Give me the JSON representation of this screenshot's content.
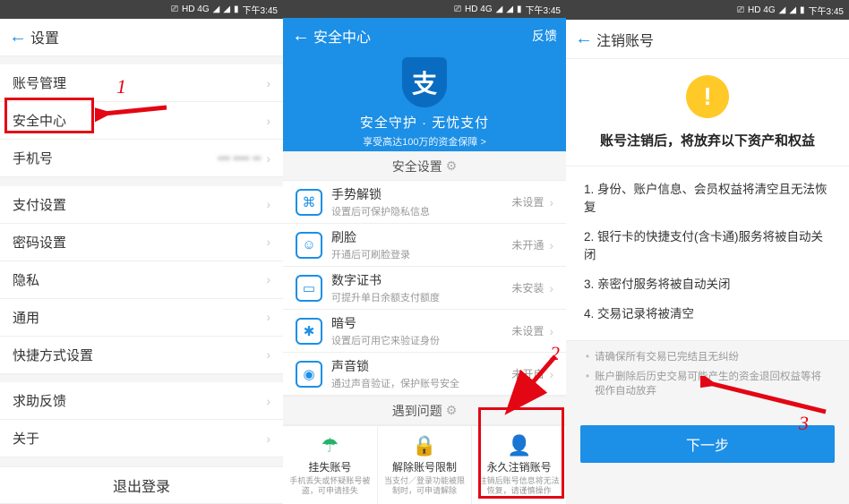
{
  "status_bar": {
    "time": "下午3:45",
    "hd": "HD 4G"
  },
  "screen1": {
    "title": "设置",
    "items_g1": [
      {
        "label": "账号管理"
      },
      {
        "label": "安全中心"
      },
      {
        "label": "手机号",
        "value": "••• •••• ••"
      }
    ],
    "items_g2": [
      {
        "label": "支付设置"
      },
      {
        "label": "密码设置"
      },
      {
        "label": "隐私"
      },
      {
        "label": "通用"
      },
      {
        "label": "快捷方式设置"
      }
    ],
    "items_g3": [
      {
        "label": "求助反馈"
      },
      {
        "label": "关于"
      }
    ],
    "logout": "退出登录"
  },
  "screen2": {
    "title": "安全中心",
    "feedback": "反馈",
    "hero_title": "安全守护 · 无忧支付",
    "hero_sub": "享受高达100万的资金保障 >",
    "section_security": "安全设置",
    "sec_items": [
      {
        "icon": "gesture-icon",
        "glyph": "⌘",
        "t1": "手势解锁",
        "t2": "设置后可保护隐私信息",
        "status": "未设置"
      },
      {
        "icon": "face-icon",
        "glyph": "☺",
        "t1": "刷脸",
        "t2": "开通后可刷脸登录",
        "status": "未开通"
      },
      {
        "icon": "cert-icon",
        "glyph": "▭",
        "t1": "数字证书",
        "t2": "可提升单日余额支付额度",
        "status": "未安装"
      },
      {
        "icon": "code-icon",
        "glyph": "✱",
        "t1": "暗号",
        "t2": "设置后可用它来验证身份",
        "status": "未设置"
      },
      {
        "icon": "voice-icon",
        "glyph": "◉",
        "t1": "声音锁",
        "t2": "通过声音验证，保护账号安全",
        "status": "未开启"
      }
    ],
    "section_problem": "遇到问题",
    "cards": [
      {
        "icon": "umbrella-icon",
        "glyph": "☂",
        "color": "#24b36b",
        "title": "挂失账号",
        "sub": "手机丢失或怀疑账号被盗，可申请挂失"
      },
      {
        "icon": "lock-icon",
        "glyph": "🔒",
        "color": "#f6a623",
        "title": "解除账号限制",
        "sub": "当支付／登录功能被限制时，可申请解除"
      },
      {
        "icon": "user-delete-icon",
        "glyph": "👤",
        "color": "#f05f57",
        "title": "永久注销账号",
        "sub": "注销后账号信息将无法恢复，请谨慎操作"
      }
    ]
  },
  "screen3": {
    "title": "注销账号",
    "warn_title": "账号注销后，将放弃以下资产和权益",
    "points": [
      "1. 身份、账户信息、会员权益将清空且无法恢复",
      "2. 银行卡的快捷支付(含卡通)服务将被自动关闭",
      "3. 亲密付服务将被自动关闭",
      "4. 交易记录将被清空"
    ],
    "notes": [
      "请确保所有交易已完结且无纠纷",
      "账户删除后历史交易可能产生的资金退回权益等将视作自动放弃"
    ],
    "next": "下一步"
  },
  "annotations": {
    "n1": "1",
    "n2": "2",
    "n3": "3"
  }
}
